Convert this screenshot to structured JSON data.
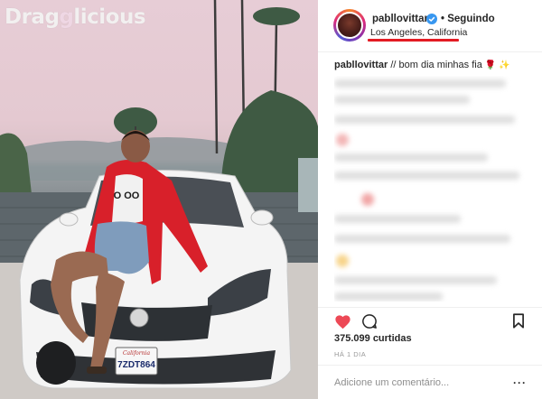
{
  "photo": {
    "watermark_a": "Drag",
    "watermark_b": "licious",
    "plate_top": "California",
    "plate_number": "7ZDT864",
    "shirt_print": "O OO"
  },
  "post": {
    "username": "pabllovittar",
    "follow_separator": "•",
    "follow_status": "Seguindo",
    "location": "Los Angeles, California",
    "caption_user": "pabllovittar",
    "caption_text": " // bom dia minhas fia ",
    "caption_emoji_1": "🌹",
    "caption_emoji_2": "✨",
    "likes": "375.099 curtidas",
    "timestamp": "HÁ 1 DIA",
    "comment_placeholder": "Adicione um comentário...",
    "more_label": "···"
  },
  "colors": {
    "accent_red": "#e31b23",
    "heart_red": "#ed4956",
    "verified_blue": "#3897f0"
  },
  "icons": [
    "heart-icon",
    "comment-icon",
    "bookmark-icon",
    "verified-icon",
    "more-icon"
  ]
}
